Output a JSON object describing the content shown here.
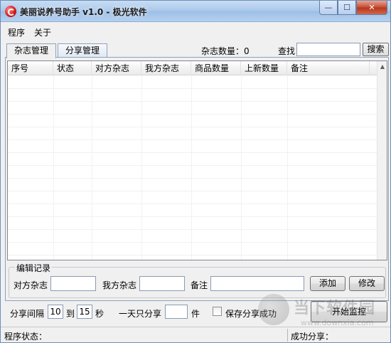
{
  "window": {
    "title": "美丽说养号助手 v1.0 - 极光软件",
    "minimize_glyph": "—",
    "maximize_glyph": "☐",
    "close_glyph": "✕"
  },
  "menu": {
    "items": [
      "程序",
      "关于"
    ]
  },
  "tabs": [
    {
      "label": "杂志管理",
      "active": true
    },
    {
      "label": "分享管理",
      "active": false
    }
  ],
  "toolbar": {
    "count_label": "杂志数量：",
    "count_value": "0",
    "find_label": "查找",
    "find_value": "",
    "search_button": "搜索"
  },
  "table": {
    "columns": [
      "序号",
      "状态",
      "对方杂志",
      "我方杂志",
      "商品数量",
      "上新数量",
      "备注"
    ],
    "rows": []
  },
  "edit_group": {
    "title": "编辑记录",
    "their_label": "对方杂志",
    "their_value": "",
    "our_label": "我方杂志",
    "our_value": "",
    "note_label": "备注",
    "note_value": "",
    "add_button": "添加",
    "modify_button": "修改"
  },
  "share_settings": {
    "interval_label": "分享间隔",
    "interval_from": "10",
    "to_label": "到",
    "interval_to": "15",
    "seconds_label": "秒",
    "daily_label": "一天只分享",
    "daily_value": "",
    "unit_label": "件",
    "save_checkbox_label": "保存分享成功",
    "save_checked": false,
    "start_button": "开始监控"
  },
  "watermark": {
    "text": "当下软件园",
    "url": "www.downxia.com"
  },
  "status": {
    "program_label": "程序状态：",
    "success_label": "成功分享："
  },
  "colors": {
    "title_gradient_top": "#c9ddf3",
    "close_button": "#c74a31",
    "window_bg": "#f0f0f0",
    "border": "#6b8fb8"
  }
}
